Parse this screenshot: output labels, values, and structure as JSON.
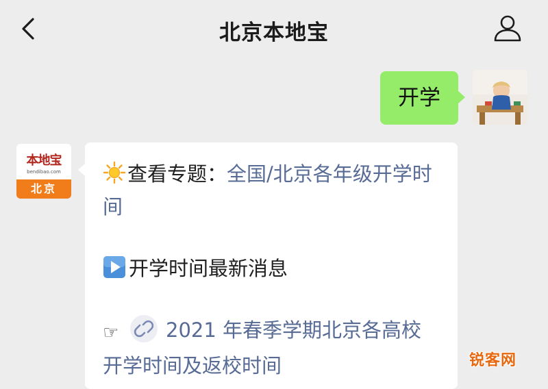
{
  "nav": {
    "title": "北京本地宝",
    "back_icon": "chevron-left-icon",
    "profile_icon": "person-icon"
  },
  "messages": {
    "outgoing": {
      "text": "开学",
      "bubble_color": "#95ec69"
    },
    "incoming": {
      "avatar": {
        "brand": "本地宝",
        "domain": "bendibao.com",
        "city": "北京"
      },
      "lines": {
        "topic_prefix": "查看专题：",
        "topic_link": "全国/北京各年级开学时间",
        "news_heading": "开学时间最新消息",
        "article_link": "2021 年春季学期北京各高校开学时间及返校时间"
      },
      "link_color": "#576b95"
    }
  },
  "watermark": {
    "text": "锐客网",
    "color": "#e8680f"
  }
}
